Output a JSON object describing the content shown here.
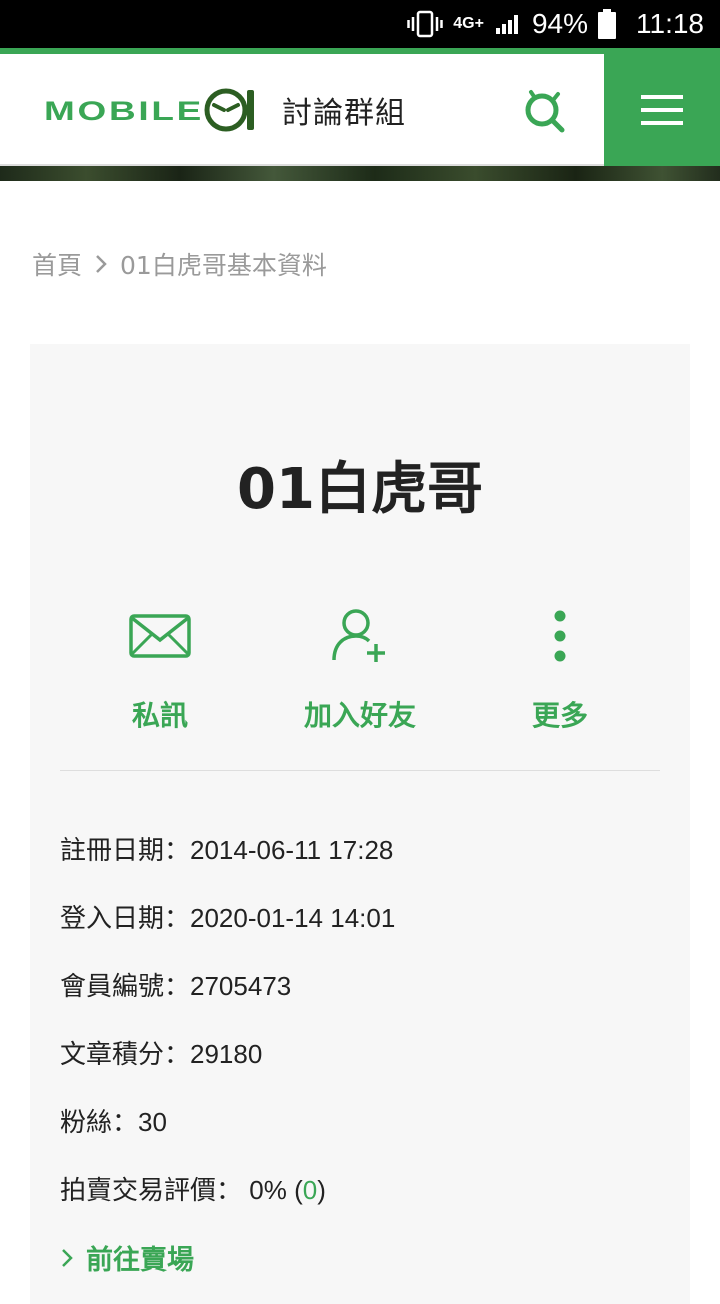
{
  "status_bar": {
    "network": "4G+",
    "battery": "94%",
    "time": "11:18"
  },
  "header": {
    "logo_text": "MOBILE01",
    "section_title": "討論群組",
    "accent_color": "#3aa655"
  },
  "breadcrumb": {
    "home": "首頁",
    "current": "01白虎哥基本資料"
  },
  "profile": {
    "username": "01白虎哥",
    "actions": [
      {
        "label": "私訊",
        "icon": "mail-icon"
      },
      {
        "label": "加入好友",
        "icon": "add-friend-icon"
      },
      {
        "label": "更多",
        "icon": "more-vertical-icon"
      }
    ],
    "info": {
      "register_label": "註冊日期：",
      "register_value": "2014-06-11 17:28",
      "login_label": "登入日期：",
      "login_value": "2020-01-14 14:01",
      "member_label": "會員編號：",
      "member_value": "2705473",
      "points_label": "文章積分：",
      "points_value": "29180",
      "fans_label": "粉絲：",
      "fans_value": "30",
      "rating_label": "拍賣交易評價：",
      "rating_value": "0%",
      "rating_open": "(",
      "rating_count": "0",
      "rating_close": ")"
    },
    "goto_market": "前往賣場"
  }
}
